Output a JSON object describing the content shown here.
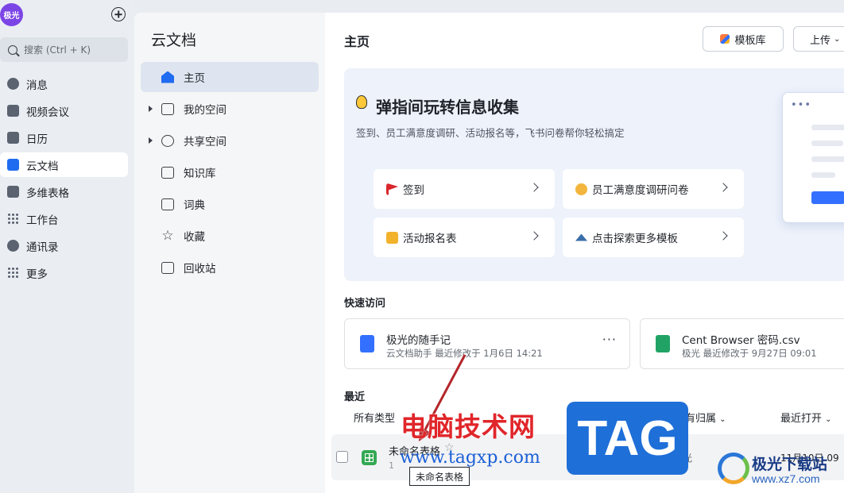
{
  "rail": {
    "avatar_text": "极光",
    "search_placeholder": "搜索 (Ctrl + K)",
    "items": [
      {
        "label": "消息",
        "icon": "chat-icon"
      },
      {
        "label": "视频会议",
        "icon": "video-icon"
      },
      {
        "label": "日历",
        "icon": "calendar-icon"
      },
      {
        "label": "云文档",
        "icon": "cloud-doc-icon",
        "active": true
      },
      {
        "label": "多维表格",
        "icon": "base-icon"
      },
      {
        "label": "工作台",
        "icon": "workplace-icon"
      },
      {
        "label": "通讯录",
        "icon": "contacts-icon"
      },
      {
        "label": "更多",
        "icon": "more-grid-icon"
      }
    ]
  },
  "subnav": {
    "title": "云文档",
    "items": [
      {
        "label": "主页",
        "icon": "home-icon",
        "active": true
      },
      {
        "label": "我的空间",
        "icon": "folder-icon",
        "expandable": true
      },
      {
        "label": "共享空间",
        "icon": "shared-icon",
        "expandable": true
      },
      {
        "label": "知识库",
        "icon": "wiki-icon"
      },
      {
        "label": "词典",
        "icon": "dictionary-icon"
      },
      {
        "label": "收藏",
        "icon": "star-icon"
      },
      {
        "label": "回收站",
        "icon": "trash-icon"
      }
    ]
  },
  "header": {
    "title": "主页",
    "template_button": "模板库",
    "upload_button": "上传"
  },
  "banner": {
    "title": "弹指间玩转信息收集",
    "subtitle": "签到、员工满意度调研、活动报名等，飞书问卷帮你轻松搞定",
    "cards": [
      {
        "label": "签到",
        "icon": "flag-icon"
      },
      {
        "label": "员工满意度调研问卷",
        "icon": "survey-icon"
      },
      {
        "label": "活动报名表",
        "icon": "beer-icon"
      },
      {
        "label": "点击探索更多模板",
        "icon": "explore-icon"
      }
    ]
  },
  "quick_access": {
    "title": "快速访问",
    "items": [
      {
        "name": "极光的随手记",
        "meta": "云文档助手 最近修改于 1月6日 14:21",
        "type": "doc",
        "more": "···"
      },
      {
        "name": "Cent Browser 密码.csv",
        "meta": "极光 最近修改于 9月27日 09:01",
        "type": "excel"
      }
    ]
  },
  "recent": {
    "title": "最近",
    "filter_type": "所有类型",
    "filter_owner": "所有归属",
    "filter_sort": "最近打开",
    "rows": [
      {
        "name": "未命名表格",
        "sub": "1",
        "owner": "极光",
        "time": "11月10日 09"
      }
    ],
    "tooltip": "未命名表格"
  },
  "watermark": {
    "text": "电脑技术网",
    "url": "www.tagxp.com",
    "tag": "TAG",
    "site": "极光下载站",
    "site_url": "www.xz7.com"
  },
  "colors": {
    "accent": "#3370ff",
    "doc_blue": "#1f6cf0",
    "sheet_green": "#34a853",
    "excel_green": "#21a366"
  }
}
